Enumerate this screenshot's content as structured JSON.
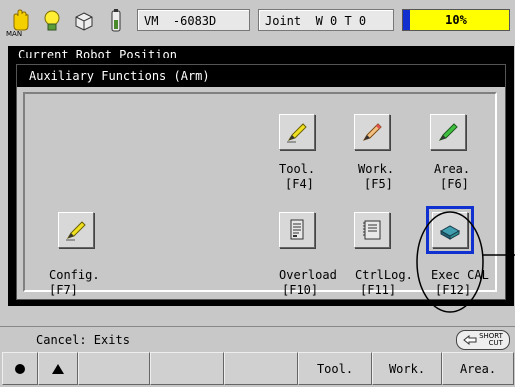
{
  "topbar": {
    "mode_label": "MAN",
    "hand_icon": "hand-icon",
    "bulb_icon": "lightbulb-icon",
    "cube_icon": "cube-icon",
    "battery_icon": "battery-icon",
    "robot_model": "VM  -6083D",
    "coord_mode": "Joint  W 0 T 0",
    "speed_percent": "10%",
    "speed_value": 10
  },
  "background_window": {
    "title": "Current Robot Position"
  },
  "dialog": {
    "title": "Auxiliary Functions (Arm)",
    "items": [
      {
        "label": "Tool.",
        "key": "[F4]",
        "icon": "pencil-yellow-icon"
      },
      {
        "label": "Work.",
        "key": "[F5]",
        "icon": "pencil-orange-icon"
      },
      {
        "label": "Area.",
        "key": "[F6]",
        "icon": "pencil-green-icon"
      },
      {
        "label": "Config.",
        "key": "[F7]",
        "icon": "pencil-yellow-icon"
      },
      {
        "label": "Overload",
        "key": "[F10]",
        "icon": "document-icon"
      },
      {
        "label": "CtrlLog.",
        "key": "[F11]",
        "icon": "notebook-icon"
      },
      {
        "label": "Exec CAL",
        "key": "[F12]",
        "icon": "calibration-icon"
      }
    ]
  },
  "status": {
    "text": "Cancel: Exits",
    "shortcut_top": "SHORT",
    "shortcut_bottom": "CUT"
  },
  "softkeys": [
    {
      "label": "",
      "icon": "circle-icon"
    },
    {
      "label": "",
      "icon": "triangle-up-icon"
    },
    {
      "label": ""
    },
    {
      "label": ""
    },
    {
      "label": ""
    },
    {
      "label": "Tool."
    },
    {
      "label": "Work."
    },
    {
      "label": "Area."
    }
  ],
  "colors": {
    "highlight": "#1030d0",
    "speed_bar": "#ffff00",
    "title_bg": "#000000"
  }
}
